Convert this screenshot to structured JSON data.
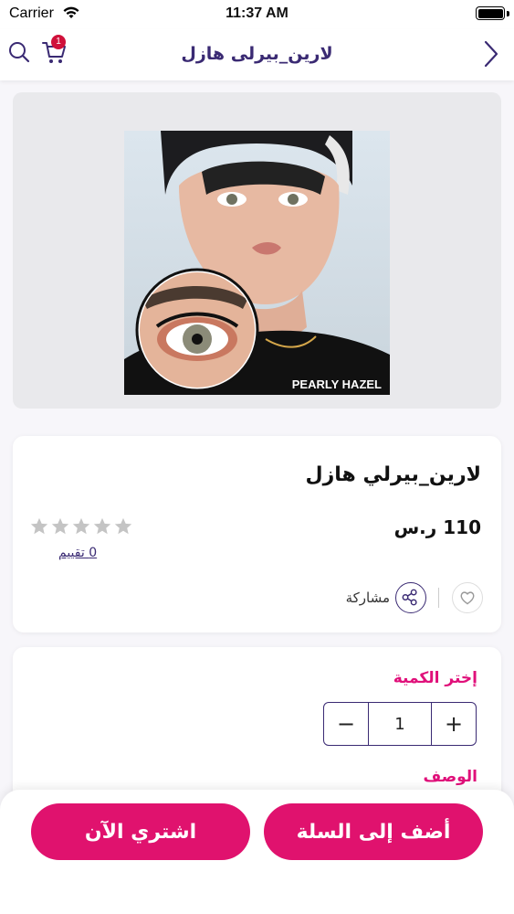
{
  "status_bar": {
    "carrier": "Carrier",
    "time": "11:37 AM"
  },
  "nav": {
    "title": "لارين_بيرلى هازل",
    "cart_count": "1",
    "icons": [
      "search-icon",
      "cart-icon",
      "chevron-right-icon"
    ]
  },
  "product": {
    "image_caption": "PEARLY HAZEL",
    "name": "لارين_بيرلي هازل",
    "price": "110 ر.س",
    "rating_value": 0,
    "rating_max": 5,
    "rating_label": "0 تقييم",
    "share_label": "مشاركة"
  },
  "quantity": {
    "label": "إختر الكمية",
    "value": "1",
    "decrement": "−",
    "increment": "+"
  },
  "description": {
    "label": "الوصف"
  },
  "actions": {
    "buy_now": "اشتري الآن",
    "add_to_cart": "أضف إلى السلة"
  },
  "colors": {
    "brand_pink": "#e0126e",
    "accent_magenta": "#e0107a",
    "nav_purple": "#3a2a73",
    "star_gray": "#c4c4c4"
  }
}
